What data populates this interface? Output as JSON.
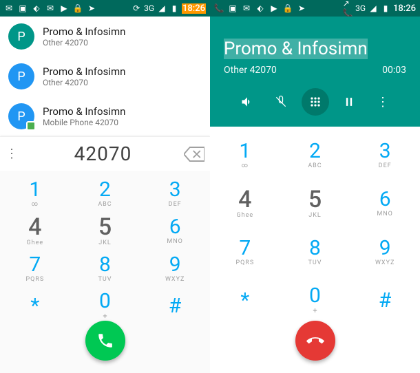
{
  "statusbar_left_icons": [
    "gmail",
    "image",
    "dropbox",
    "gmail",
    "youtube",
    "lock",
    "telegram"
  ],
  "statusbar_right": {
    "net": "3G",
    "time": "18:26"
  },
  "screen1": {
    "suggestions": [
      {
        "avatar_letter": "P",
        "avatar_color": "green",
        "title": "Promo & Infosimn",
        "sub": "Other 42070"
      },
      {
        "avatar_letter": "P",
        "avatar_color": "blue",
        "title": "Promo & Infosimn",
        "sub": "Other 42070"
      },
      {
        "avatar_letter": "P",
        "avatar_color": "blue",
        "badge": true,
        "title": "Promo & Infosimn",
        "sub": "Mobile Phone 42070"
      }
    ],
    "dialed": "42070"
  },
  "screen2": {
    "call_name": "Promo & Infosimn",
    "call_sub": "Other 42070",
    "call_time": "00:03"
  },
  "dialpad": [
    {
      "d": "1",
      "l": "∞"
    },
    {
      "d": "2",
      "l": "ABC"
    },
    {
      "d": "3",
      "l": "DEF"
    },
    {
      "d": "4",
      "l": "Ghee",
      "dark": true
    },
    {
      "d": "5",
      "l": "JKL",
      "dark": true
    },
    {
      "d": "6",
      "l": "MNO"
    },
    {
      "d": "7",
      "l": "PQRS"
    },
    {
      "d": "8",
      "l": "TUV"
    },
    {
      "d": "9",
      "l": "WXYZ"
    },
    {
      "d": "*",
      "l": ""
    },
    {
      "d": "0",
      "l": "+",
      "plus": true
    },
    {
      "d": "#",
      "l": ""
    }
  ]
}
